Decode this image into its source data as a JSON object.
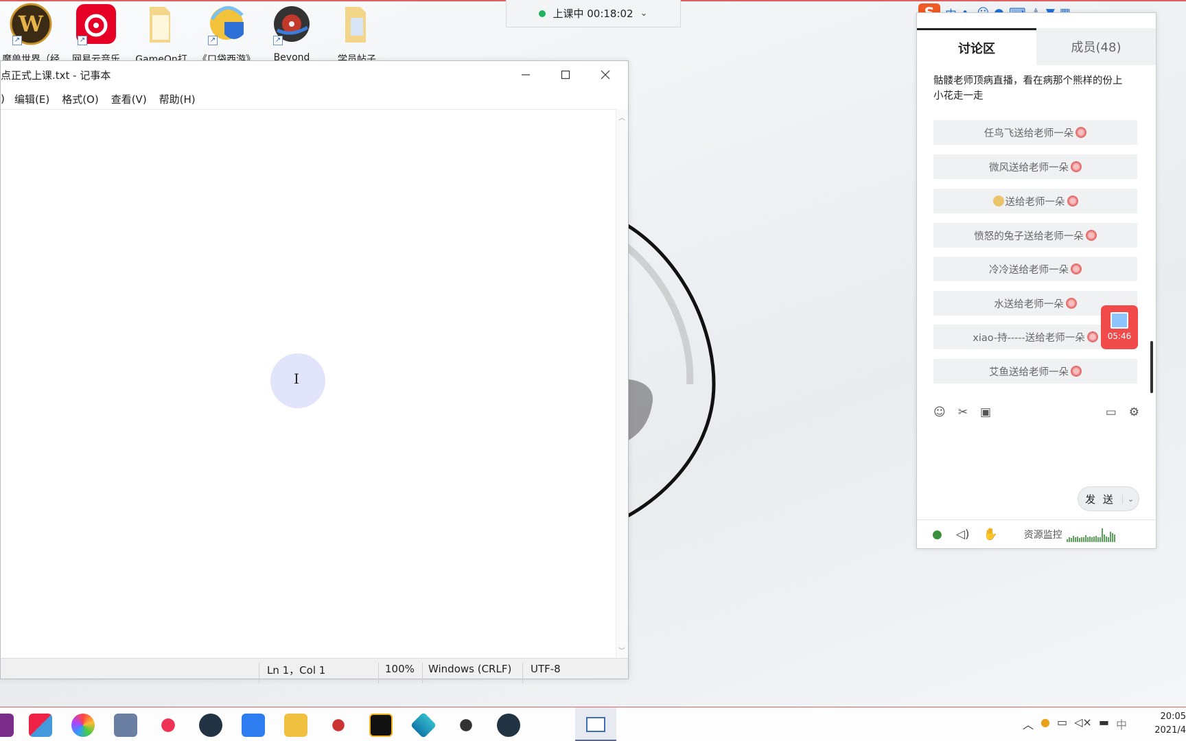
{
  "desktop": {
    "icons": [
      {
        "label": "魔兽世界（经"
      },
      {
        "label": "网易云音乐"
      },
      {
        "label": "GameOn打"
      },
      {
        "label": "《口袋西游》"
      },
      {
        "label": "Beyond"
      },
      {
        "label": "学员帖子"
      }
    ]
  },
  "class_timer": {
    "text": "上课中 00:18:02",
    "chevron": "⌄"
  },
  "notepad": {
    "title": "点正式上课.txt - 记事本",
    "menu": [
      "编辑(E)",
      "格式(O)",
      "查看(V)",
      "帮助(H)"
    ],
    "status": {
      "position": "Ln 1，Col 1",
      "zoom": "100%",
      "line_ending": "Windows (CRLF)",
      "encoding": "UTF-8"
    }
  },
  "chat": {
    "ime_toolbar": {
      "logo": "S",
      "mode": "中",
      "punct": "•,"
    },
    "tabs": [
      {
        "label": "讨论区"
      },
      {
        "label": "成员(48)"
      }
    ],
    "message": "骷髅老师顶病直播，看在病那个熊样的份上 小花走一走",
    "flowers": [
      "任鸟飞送给老师一朵",
      "微风送给老师一朵",
      "送给老师一朵",
      "愤怒的兔子送给老师一朵",
      "冷冷送给老师一朵",
      "水送给老师一朵",
      "xiao-持-----送给老师一朵",
      "艾鱼送给老师一朵"
    ],
    "gift_timer": "05:46",
    "send_label": "发 送",
    "resource_monitor": "资源监控",
    "monitor_levels": [
      0.2,
      0.3,
      0.25,
      0.4,
      0.3,
      0.35,
      0.28,
      0.32,
      0.3,
      0.45,
      0.3,
      0.38,
      0.3,
      0.35,
      0.4,
      0.32,
      0.3,
      0.9,
      0.5,
      0.35,
      0.3,
      0.7,
      0.6,
      0.5
    ]
  },
  "taskbar": {
    "tray_ime": "中",
    "time": "20:05",
    "date": "2021/4"
  },
  "colors": {
    "accent_red": "#e0615f",
    "live_green": "#22b35e",
    "gift_red": "#f04a4a"
  }
}
